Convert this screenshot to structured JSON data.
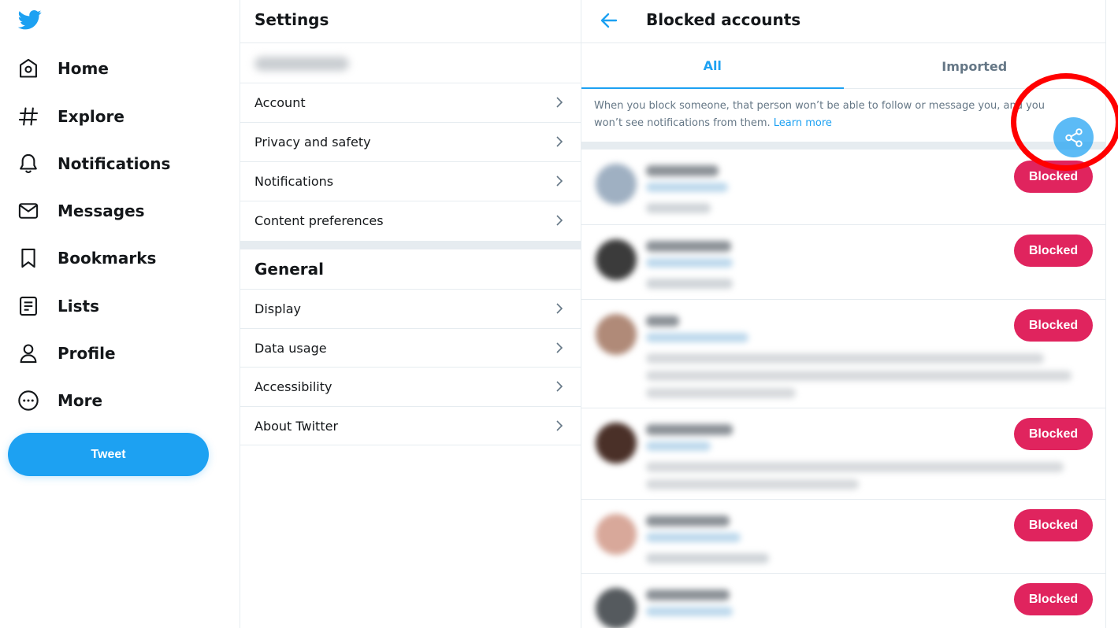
{
  "nav": {
    "items": [
      {
        "label": "Home",
        "icon": "home-icon"
      },
      {
        "label": "Explore",
        "icon": "hashtag-icon"
      },
      {
        "label": "Notifications",
        "icon": "bell-icon"
      },
      {
        "label": "Messages",
        "icon": "mail-icon"
      },
      {
        "label": "Bookmarks",
        "icon": "bookmark-icon"
      },
      {
        "label": "Lists",
        "icon": "list-icon"
      },
      {
        "label": "Profile",
        "icon": "person-icon"
      },
      {
        "label": "More",
        "icon": "more-dots-icon"
      }
    ],
    "tweet_label": "Tweet"
  },
  "settings": {
    "title": "Settings",
    "account_items": [
      "Account",
      "Privacy and safety",
      "Notifications",
      "Content preferences"
    ],
    "general_title": "General",
    "general_items": [
      "Display",
      "Data usage",
      "Accessibility",
      "About Twitter"
    ]
  },
  "blocked": {
    "title": "Blocked accounts",
    "tabs": [
      "All",
      "Imported"
    ],
    "info_text": "When you block someone, that person won’t be able to follow or message you, and you won’t see notifications from them.",
    "learn_more": "Learn more",
    "button_label": "Blocked",
    "account_count": 6
  },
  "colors": {
    "accent": "#1da1f2",
    "blocked_button": "#e0245e",
    "annotation_ring": "#ff0000"
  }
}
